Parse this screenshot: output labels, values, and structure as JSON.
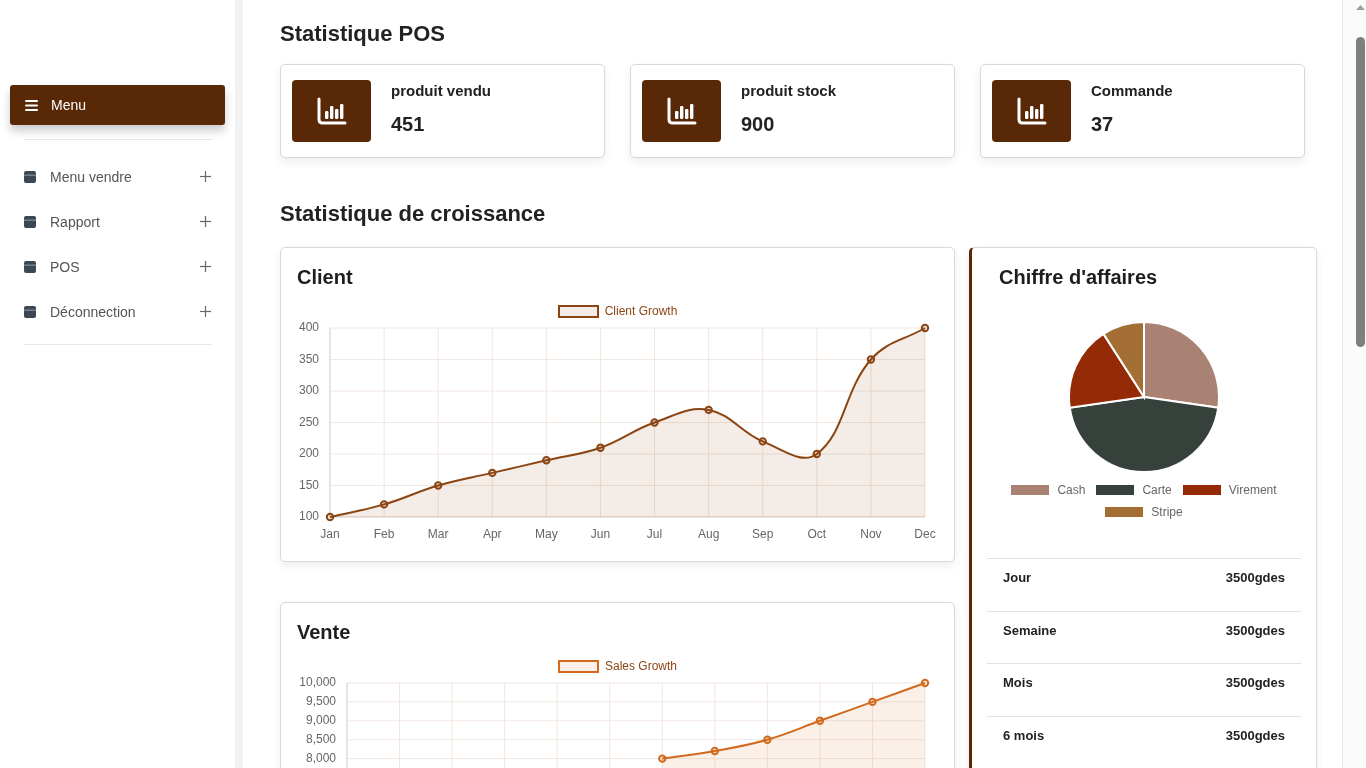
{
  "sidebar": {
    "menu_button": {
      "label": "Menu"
    },
    "items": [
      {
        "label": "Menu vendre",
        "expanded": false
      },
      {
        "label": "Rapport",
        "expanded": false
      },
      {
        "label": "POS",
        "expanded": false
      },
      {
        "label": "Déconnection",
        "expanded": false
      }
    ]
  },
  "pos_stats": {
    "title": "Statistique POS",
    "cards": [
      {
        "label": "produit vendu",
        "value": "451"
      },
      {
        "label": "produit stock",
        "value": "900"
      },
      {
        "label": "Commande",
        "value": "37"
      }
    ]
  },
  "growth": {
    "title": "Statistique de croissance",
    "charts": [
      {
        "title": "Client",
        "chart_data": {
          "type": "area",
          "grid": true,
          "categories": [
            "Jan",
            "Feb",
            "Mar",
            "Apr",
            "May",
            "Jun",
            "Jul",
            "Aug",
            "Sep",
            "Oct",
            "Nov",
            "Dec"
          ],
          "series": [
            {
              "name": "Client Growth",
              "color": "#8b4513",
              "marker": "circle",
              "values": [
                100,
                120,
                150,
                170,
                190,
                210,
                250,
                270,
                220,
                200,
                350,
                400
              ]
            }
          ],
          "ylim": [
            100,
            400
          ],
          "yticks": [
            100,
            150,
            200,
            250,
            300,
            350,
            400
          ]
        }
      },
      {
        "title": "Vente",
        "chart_data": {
          "type": "area",
          "grid": true,
          "series": [
            {
              "name": "Sales Growth",
              "color": "#d2691e",
              "marker": "circle",
              "values": [
                null,
                null,
                null,
                null,
                null,
                null,
                8000,
                8200,
                8500,
                9000,
                9500,
                10000
              ]
            }
          ],
          "ylim": [
            5000,
            10000
          ],
          "yticks": [
            {
              "value": 8000,
              "label": "8,000"
            },
            {
              "value": 8500,
              "label": "8,500"
            },
            {
              "value": 9000,
              "label": "9,000"
            },
            {
              "value": 9500,
              "label": "9,500"
            },
            {
              "value": 10000,
              "label": "10,000"
            }
          ]
        }
      }
    ],
    "revenue": {
      "title": "Chiffre d'affaires",
      "legend": [
        {
          "label": "Cash",
          "color": "#aa8274"
        },
        {
          "label": "Carte",
          "color": "#37413c"
        },
        {
          "label": "Virement",
          "color": "#952b06"
        },
        {
          "label": "Stripe",
          "color": "#a36f34"
        }
      ],
      "rows": [
        {
          "period": "Jour",
          "amount": "3500gdes"
        },
        {
          "period": "Semaine",
          "amount": "3500gdes"
        },
        {
          "period": "Mois",
          "amount": "3500gdes"
        },
        {
          "period": "6 mois",
          "amount": "3500gdes"
        }
      ]
    }
  }
}
